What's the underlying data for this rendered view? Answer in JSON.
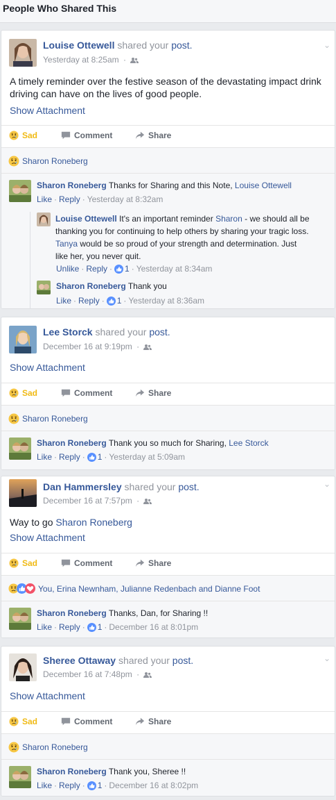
{
  "header": {
    "title": "People Who Shared This"
  },
  "common": {
    "shared_your": "shared your",
    "post": "post.",
    "show_attachment": "Show Attachment",
    "sad": "Sad",
    "comment": "Comment",
    "share": "Share",
    "like": "Like",
    "unlike": "Unlike",
    "reply": "Reply",
    "dot": "·"
  },
  "stories": [
    {
      "author": "Louise Ottewell",
      "time": "Yesterday at 8:25am",
      "message": "A timely reminder over the festive season of the devastating impact drink driving can have on the lives of good people.",
      "reactors": "Sharon Roneberg",
      "comments": [
        {
          "author": "Sharon Roneberg",
          "text": "Thanks for Sharing and this Note,",
          "mention": "Louise Ottewell",
          "time": "Yesterday at 8:32am"
        }
      ],
      "replies": [
        {
          "author": "Louise Ottewell",
          "line1_a": "It's an important reminder",
          "line1_mention": "Sharon",
          "line1_b": "- we should all be",
          "line2": "thanking you for continuing to help others by sharing your tragic loss.",
          "line3_mention": "Tanya",
          "line3_b": "would be so proud of your strength and determination. Just",
          "line4": "like her, you never quit.",
          "likes": "1",
          "time": "Yesterday at 8:34am"
        },
        {
          "author": "Sharon Roneberg",
          "text": "Thank you",
          "likes": "1",
          "time": "Yesterday at 8:36am"
        }
      ]
    },
    {
      "author": "Lee Storck",
      "time": "December 16 at 9:19pm",
      "reactors": "Sharon Roneberg",
      "comments": [
        {
          "author": "Sharon Roneberg",
          "text": "Thank you so much for Sharing,",
          "mention": "Lee Storck",
          "likes": "1",
          "time": "Yesterday at 5:09am"
        }
      ]
    },
    {
      "author": "Dan Hammersley",
      "time": "December 16 at 7:57pm",
      "message": "Way to go",
      "message_mention": "Sharon Roneberg",
      "reactors": "You, Erina Newnham, Julianne Redenbach and Dianne Foot",
      "comments": [
        {
          "author": "Sharon Roneberg",
          "text": "Thanks, Dan, for Sharing !!",
          "likes": "1",
          "time": "December 16 at 8:01pm"
        }
      ]
    },
    {
      "author": "Sheree Ottaway",
      "time": "December 16 at 7:48pm",
      "reactors": "Sharon Roneberg",
      "comments": [
        {
          "author": "Sharon Roneberg",
          "text": "Thank you, Sheree !!",
          "likes": "1",
          "time": "December 16 at 8:02pm"
        }
      ]
    }
  ],
  "colors": {
    "link": "#365899",
    "sad": "#f0ba15",
    "muted": "#90949c",
    "like_blue": "#5890ff",
    "love_red": "#f25268"
  }
}
